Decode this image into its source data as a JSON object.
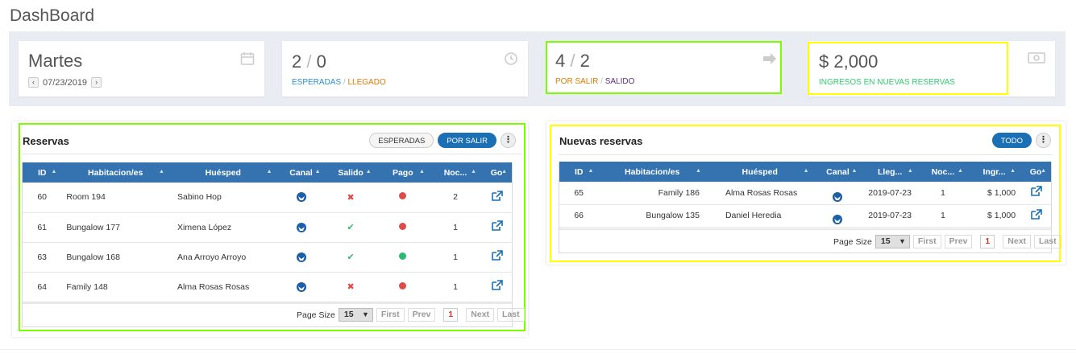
{
  "page_title": "DashBoard",
  "stats": {
    "date": {
      "day": "Martes",
      "date": "07/23/2019",
      "prev": "‹",
      "next": "›"
    },
    "arrivals": {
      "a": "2",
      "b": "0",
      "label_a": "ESPERADAS",
      "label_b": "LLEGADO",
      "sep": "/"
    },
    "departures": {
      "a": "4",
      "b": "2",
      "label_a": "POR SALIR",
      "label_b": "SALIDO",
      "sep": "/"
    },
    "revenue": {
      "value": "$ 2,000",
      "label": "INGRESOS EN NUEVAS RESERVAS"
    }
  },
  "reservas": {
    "title": "Reservas",
    "btn_esperadas": "ESPERADAS",
    "btn_por_salir": "POR SALIR",
    "kebab": "⋮",
    "columns": [
      "ID",
      "Habitacion/es",
      "Huésped",
      "Canal",
      "Salido",
      "Pago",
      "Noc...",
      "Go"
    ],
    "rows": [
      {
        "id": "60",
        "room": "Room 194",
        "guest": "Sabino Hop",
        "salido": "✖",
        "pago": "red",
        "noches": "2"
      },
      {
        "id": "61",
        "room": "Bungalow 177",
        "guest": "Ximena López",
        "salido": "✔",
        "pago": "red",
        "noches": "1"
      },
      {
        "id": "63",
        "room": "Bungalow 168",
        "guest": "Ana Arroyo Arroyo",
        "salido": "✔",
        "pago": "green",
        "noches": "1"
      },
      {
        "id": "64",
        "room": "Family 148",
        "guest": "Alma Rosas Rosas",
        "salido": "✖",
        "pago": "red",
        "noches": "1"
      }
    ],
    "pager": {
      "page_size_label": "Page Size",
      "page_size": "15",
      "first": "First",
      "prev": "Prev",
      "current": "1",
      "next": "Next",
      "last": "Last"
    }
  },
  "nuevas": {
    "title": "Nuevas reservas",
    "btn_todo": "TODO",
    "kebab": "⋮",
    "columns": [
      "ID",
      "Habitacion/es",
      "Huésped",
      "Canal",
      "Lleg...",
      "Noc...",
      "Ingr...",
      "Go"
    ],
    "rows": [
      {
        "id": "65",
        "room": "Family 186",
        "guest": "Alma Rosas Rosas",
        "llegada": "2019-07-23",
        "noches": "1",
        "ingreso": "$ 1,000"
      },
      {
        "id": "66",
        "room": "Bungalow 135",
        "guest": "Daniel Heredia",
        "llegada": "2019-07-23",
        "noches": "1",
        "ingreso": "$ 1,000"
      }
    ],
    "pager": {
      "page_size_label": "Page Size",
      "page_size": "15",
      "first": "First",
      "prev": "Prev",
      "current": "1",
      "next": "Next",
      "last": "Last"
    }
  },
  "colors": {
    "header_blue": "#3572b0",
    "accent_blue": "#1a6fb5",
    "arrivals_label": "#2a8fcf",
    "arrivals_label_b": "#e07b00",
    "departures_label": "#e07b00",
    "departures_label_b": "#5a2d82",
    "revenue_label": "#2ecc71",
    "dot_red": "#dd4b4b",
    "dot_green": "#2eb872",
    "highlight_green": "#7cfc00",
    "highlight_yellow": "#ffff00"
  }
}
